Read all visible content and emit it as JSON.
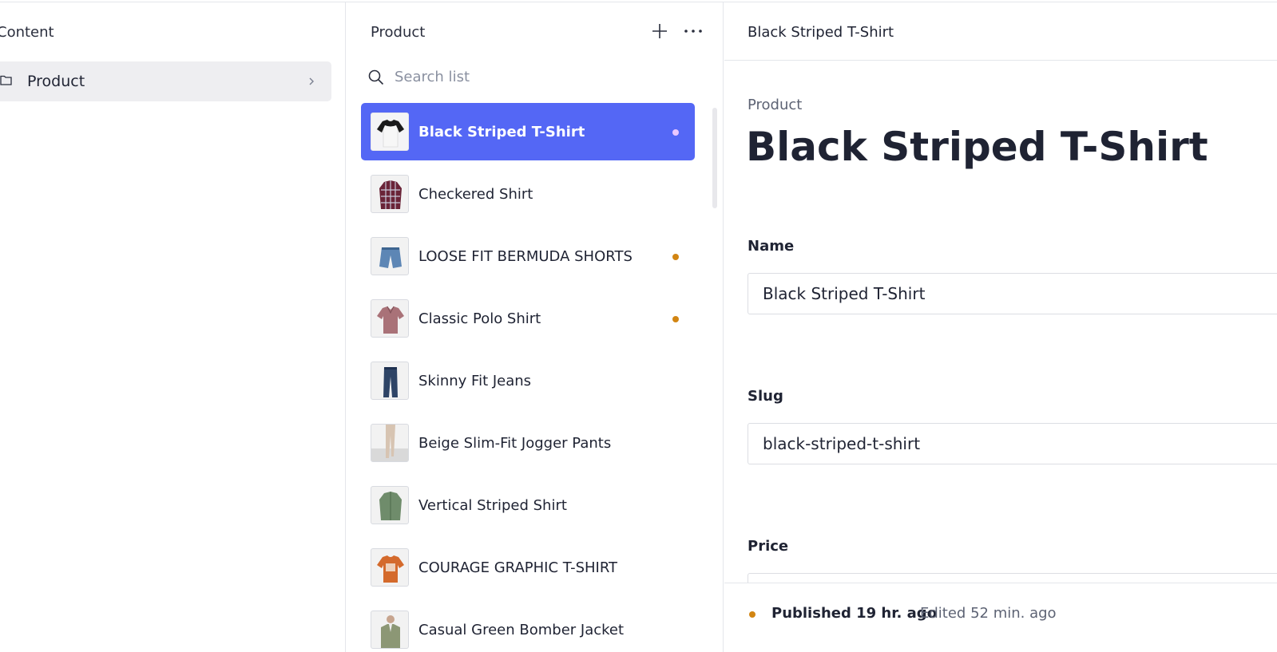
{
  "content_pane": {
    "title": "Content",
    "nav_item": {
      "label": "Product"
    }
  },
  "list_pane": {
    "title": "Product",
    "search_placeholder": "Search list",
    "items": [
      {
        "name": "Black Striped T-Shirt",
        "selected": true,
        "status_dot": true
      },
      {
        "name": "Checkered Shirt",
        "selected": false,
        "status_dot": false
      },
      {
        "name": "LOOSE FIT BERMUDA SHORTS",
        "selected": false,
        "status_dot": true
      },
      {
        "name": "Classic Polo Shirt",
        "selected": false,
        "status_dot": true
      },
      {
        "name": "Skinny Fit Jeans",
        "selected": false,
        "status_dot": false
      },
      {
        "name": "Beige Slim-Fit Jogger Pants",
        "selected": false,
        "status_dot": false
      },
      {
        "name": "Vertical Striped Shirt",
        "selected": false,
        "status_dot": false
      },
      {
        "name": "COURAGE GRAPHIC T-SHIRT",
        "selected": false,
        "status_dot": false
      },
      {
        "name": "Casual Green Bomber Jacket",
        "selected": false,
        "status_dot": false
      }
    ]
  },
  "document": {
    "header_title": "Black Striped T-Shirt",
    "type": "Product",
    "title": "Black Striped T-Shirt",
    "fields": {
      "name": {
        "label": "Name",
        "value": "Black Striped T-Shirt"
      },
      "slug": {
        "label": "Slug",
        "value": "black-striped-t-shirt"
      },
      "price": {
        "label": "Price",
        "value": ""
      }
    },
    "status": {
      "published": "Published 19 hr. ago",
      "edited": "Edited 52 min. ago"
    }
  },
  "colors": {
    "selected_row": "#5467f5",
    "status_dot": "#d28512",
    "selected_dot": "#eac8ff"
  }
}
